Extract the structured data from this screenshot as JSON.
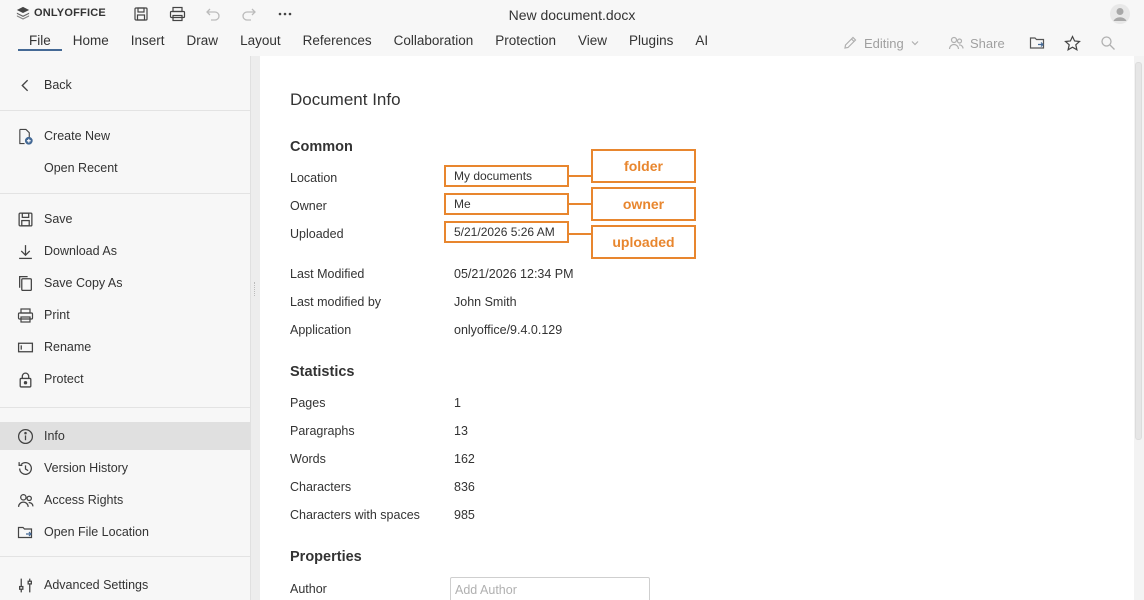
{
  "app": {
    "logo_text": "ONLYOFFICE",
    "doc_title": "New document.docx"
  },
  "menu": [
    "File",
    "Home",
    "Insert",
    "Draw",
    "Layout",
    "References",
    "Collaboration",
    "Protection",
    "View",
    "Plugins",
    "AI"
  ],
  "toolbar": {
    "editing_label": "Editing",
    "share_label": "Share"
  },
  "sidebar": {
    "back": "Back",
    "items": [
      "Create New",
      "Open Recent",
      "Save",
      "Download As",
      "Save Copy As",
      "Print",
      "Rename",
      "Protect",
      "Info",
      "Version History",
      "Access Rights",
      "Open File Location",
      "Advanced Settings"
    ],
    "active": "Info"
  },
  "info": {
    "title": "Document Info",
    "common": {
      "heading": "Common",
      "location_label": "Location",
      "location_value": "My documents",
      "owner_label": "Owner",
      "owner_value": "Me",
      "uploaded_label": "Uploaded",
      "uploaded_value": "5/21/2026 5:26 AM",
      "last_modified_label": "Last Modified",
      "last_modified_value": "05/21/2026 12:34 PM",
      "last_modified_by_label": "Last modified by",
      "last_modified_by_value": "John Smith",
      "application_label": "Application",
      "application_value": "onlyoffice/9.4.0.129"
    },
    "callouts": {
      "folder": "folder",
      "owner": "owner",
      "uploaded": "uploaded"
    },
    "statistics": {
      "heading": "Statistics",
      "pages_label": "Pages",
      "pages_value": "1",
      "paragraphs_label": "Paragraphs",
      "paragraphs_value": "13",
      "words_label": "Words",
      "words_value": "162",
      "characters_label": "Characters",
      "characters_value": "836",
      "characters_spaces_label": "Characters with spaces",
      "characters_spaces_value": "985"
    },
    "properties": {
      "heading": "Properties",
      "author_label": "Author",
      "author_placeholder": "Add Author"
    }
  },
  "colors": {
    "accent": "#446995",
    "highlight": "#e8862e"
  }
}
